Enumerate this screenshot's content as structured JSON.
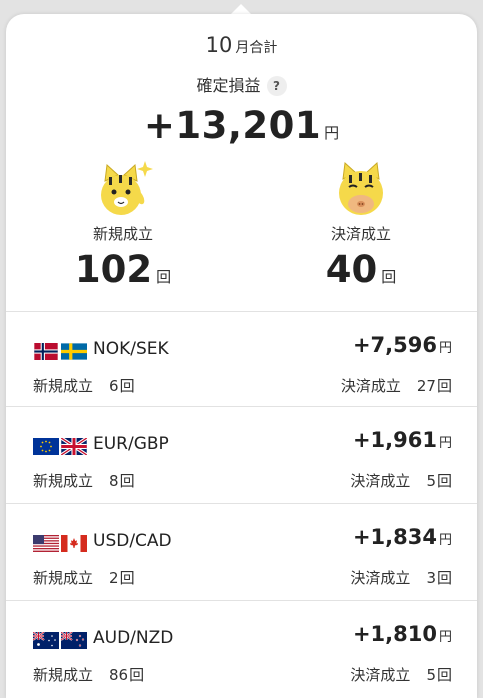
{
  "summary": {
    "month": "10",
    "month_suffix": "月合計",
    "title": "確定損益",
    "help_icon": "?",
    "total": "+13,201",
    "total_unit": "円",
    "new": {
      "label": "新規成立",
      "value": "102",
      "unit": "回"
    },
    "settle": {
      "label": "決済成立",
      "value": "40",
      "unit": "回"
    }
  },
  "colors": {
    "mascot_yellow": "#f5d94a",
    "text": "#222222",
    "divider": "#e2e2e2"
  },
  "pairs": [
    {
      "name": "NOK/SEK",
      "flags": [
        "norway-flag-icon",
        "sweden-flag-icon"
      ],
      "profit": "+7,596",
      "unit": "円",
      "new_label": "新規成立",
      "new_count": "6",
      "settle_label": "決済成立",
      "settle_count": "27",
      "count_unit": "回"
    },
    {
      "name": "EUR/GBP",
      "flags": [
        "eu-flag-icon",
        "uk-flag-icon"
      ],
      "profit": "+1,961",
      "unit": "円",
      "new_label": "新規成立",
      "new_count": "8",
      "settle_label": "決済成立",
      "settle_count": "5",
      "count_unit": "回"
    },
    {
      "name": "USD/CAD",
      "flags": [
        "us-flag-icon",
        "canada-flag-icon"
      ],
      "profit": "+1,834",
      "unit": "円",
      "new_label": "新規成立",
      "new_count": "2",
      "settle_label": "決済成立",
      "settle_count": "3",
      "count_unit": "回"
    },
    {
      "name": "AUD/NZD",
      "flags": [
        "australia-flag-icon",
        "new-zealand-flag-icon"
      ],
      "profit": "+1,810",
      "unit": "円",
      "new_label": "新規成立",
      "new_count": "86",
      "settle_label": "決済成立",
      "settle_count": "5",
      "count_unit": "回"
    }
  ]
}
